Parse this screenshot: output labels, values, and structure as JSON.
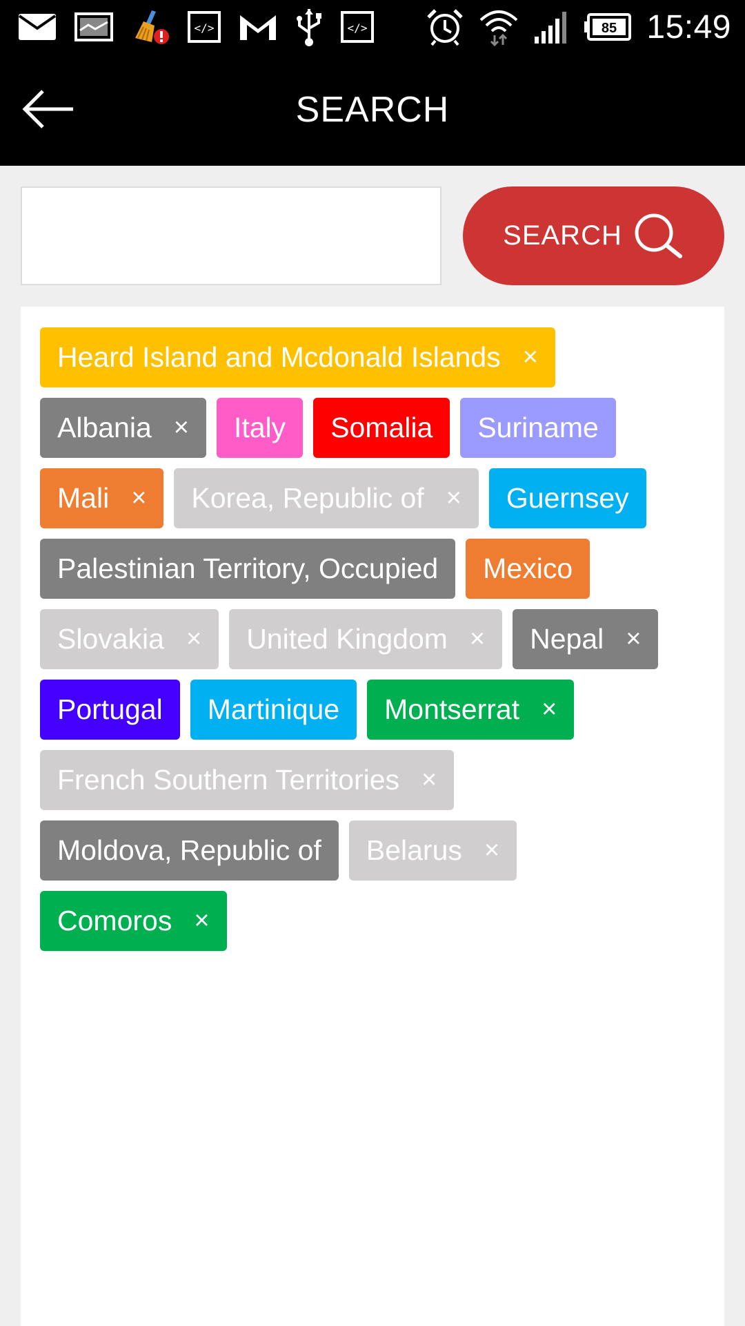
{
  "status_bar": {
    "time": "15:49",
    "battery_level": "85",
    "left_icons": [
      "mail-icon",
      "image-icon",
      "cleaner-alert-icon",
      "code-icon",
      "gmail-icon",
      "usb-icon",
      "code-icon"
    ],
    "right_icons": [
      "alarm-icon",
      "wifi-icon",
      "signal-icon",
      "battery-icon"
    ]
  },
  "app_bar": {
    "title": "SEARCH",
    "back_icon": "arrow-left-icon"
  },
  "search": {
    "input_value": "",
    "placeholder": "",
    "button_label": "SEARCH",
    "button_color": "#cd3434",
    "button_icon": "search-icon"
  },
  "tags": {
    "remove_symbol": "×",
    "rows": [
      [
        {
          "label": "Heard Island and Mcdonald Islands",
          "color": "#ffc000",
          "removable": true
        }
      ],
      [
        {
          "label": "Albania",
          "color": "#808080",
          "removable": true
        },
        {
          "label": "Italy",
          "color": "#ff5cc8",
          "removable": false
        },
        {
          "label": "Somalia",
          "color": "#ff0000",
          "removable": false
        },
        {
          "label": "Suriname",
          "color": "#9b9bff",
          "removable": false
        }
      ],
      [
        {
          "label": "Mali",
          "color": "#ef7d31",
          "removable": true
        },
        {
          "label": "Korea, Republic of",
          "color": "#d0cece",
          "removable": true
        },
        {
          "label": "Guernsey",
          "color": "#00b0f0",
          "removable": false
        }
      ],
      [
        {
          "label": "Palestinian Territory, Occupied",
          "color": "#808080",
          "removable": false
        },
        {
          "label": "Mexico",
          "color": "#ef7d31",
          "removable": false
        }
      ],
      [
        {
          "label": "Slovakia",
          "color": "#d0cece",
          "removable": true
        },
        {
          "label": "United Kingdom",
          "color": "#d0cece",
          "removable": true
        },
        {
          "label": "Nepal",
          "color": "#808080",
          "removable": true
        }
      ],
      [
        {
          "label": "Portugal",
          "color": "#4400ff",
          "removable": false
        },
        {
          "label": "Martinique",
          "color": "#00b0f0",
          "removable": false
        },
        {
          "label": "Montserrat",
          "color": "#00b050",
          "removable": true
        }
      ],
      [
        {
          "label": "French Southern Territories",
          "color": "#d0cece",
          "removable": true
        }
      ],
      [
        {
          "label": "Moldova, Republic of",
          "color": "#808080",
          "removable": false
        },
        {
          "label": "Belarus",
          "color": "#d0cece",
          "removable": true
        }
      ],
      [
        {
          "label": "Comoros",
          "color": "#00b050",
          "removable": true
        }
      ]
    ]
  }
}
